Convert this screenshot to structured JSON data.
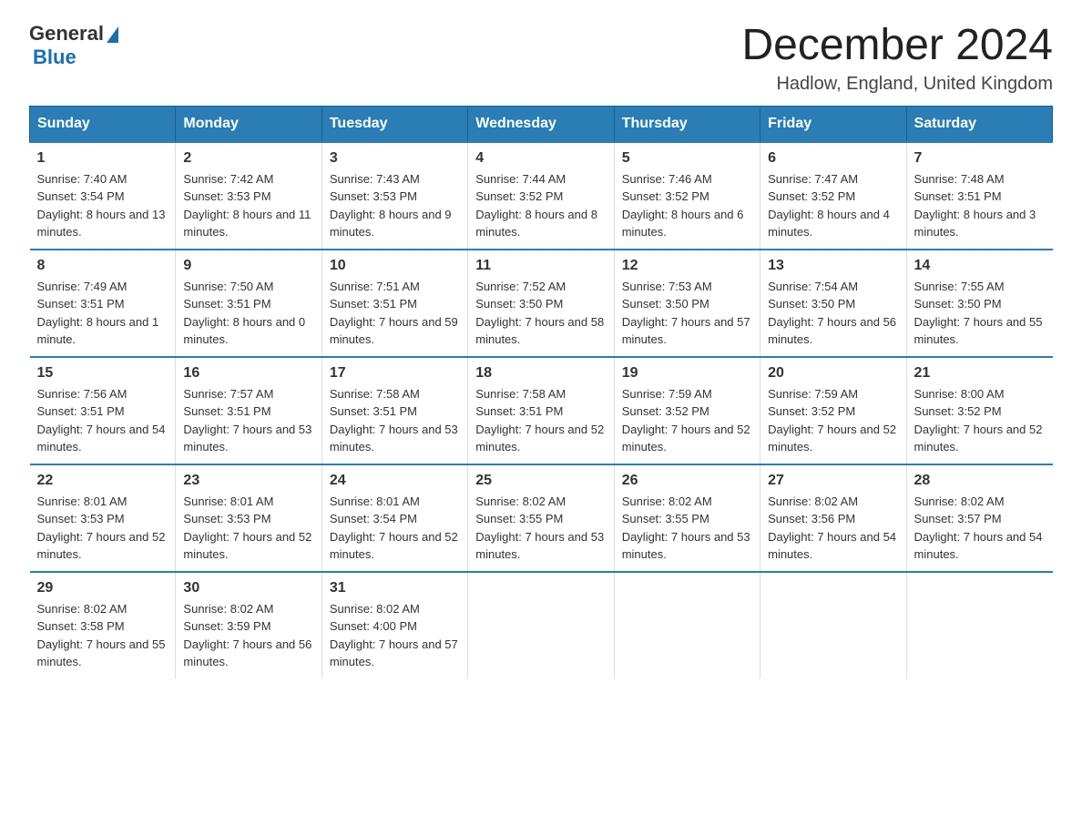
{
  "header": {
    "logo": {
      "general": "General",
      "blue": "Blue"
    },
    "title": "December 2024",
    "location": "Hadlow, England, United Kingdom"
  },
  "weekdays": [
    "Sunday",
    "Monday",
    "Tuesday",
    "Wednesday",
    "Thursday",
    "Friday",
    "Saturday"
  ],
  "weeks": [
    [
      {
        "day": "1",
        "sunrise": "7:40 AM",
        "sunset": "3:54 PM",
        "daylight": "8 hours and 13 minutes."
      },
      {
        "day": "2",
        "sunrise": "7:42 AM",
        "sunset": "3:53 PM",
        "daylight": "8 hours and 11 minutes."
      },
      {
        "day": "3",
        "sunrise": "7:43 AM",
        "sunset": "3:53 PM",
        "daylight": "8 hours and 9 minutes."
      },
      {
        "day": "4",
        "sunrise": "7:44 AM",
        "sunset": "3:52 PM",
        "daylight": "8 hours and 8 minutes."
      },
      {
        "day": "5",
        "sunrise": "7:46 AM",
        "sunset": "3:52 PM",
        "daylight": "8 hours and 6 minutes."
      },
      {
        "day": "6",
        "sunrise": "7:47 AM",
        "sunset": "3:52 PM",
        "daylight": "8 hours and 4 minutes."
      },
      {
        "day": "7",
        "sunrise": "7:48 AM",
        "sunset": "3:51 PM",
        "daylight": "8 hours and 3 minutes."
      }
    ],
    [
      {
        "day": "8",
        "sunrise": "7:49 AM",
        "sunset": "3:51 PM",
        "daylight": "8 hours and 1 minute."
      },
      {
        "day": "9",
        "sunrise": "7:50 AM",
        "sunset": "3:51 PM",
        "daylight": "8 hours and 0 minutes."
      },
      {
        "day": "10",
        "sunrise": "7:51 AM",
        "sunset": "3:51 PM",
        "daylight": "7 hours and 59 minutes."
      },
      {
        "day": "11",
        "sunrise": "7:52 AM",
        "sunset": "3:50 PM",
        "daylight": "7 hours and 58 minutes."
      },
      {
        "day": "12",
        "sunrise": "7:53 AM",
        "sunset": "3:50 PM",
        "daylight": "7 hours and 57 minutes."
      },
      {
        "day": "13",
        "sunrise": "7:54 AM",
        "sunset": "3:50 PM",
        "daylight": "7 hours and 56 minutes."
      },
      {
        "day": "14",
        "sunrise": "7:55 AM",
        "sunset": "3:50 PM",
        "daylight": "7 hours and 55 minutes."
      }
    ],
    [
      {
        "day": "15",
        "sunrise": "7:56 AM",
        "sunset": "3:51 PM",
        "daylight": "7 hours and 54 minutes."
      },
      {
        "day": "16",
        "sunrise": "7:57 AM",
        "sunset": "3:51 PM",
        "daylight": "7 hours and 53 minutes."
      },
      {
        "day": "17",
        "sunrise": "7:58 AM",
        "sunset": "3:51 PM",
        "daylight": "7 hours and 53 minutes."
      },
      {
        "day": "18",
        "sunrise": "7:58 AM",
        "sunset": "3:51 PM",
        "daylight": "7 hours and 52 minutes."
      },
      {
        "day": "19",
        "sunrise": "7:59 AM",
        "sunset": "3:52 PM",
        "daylight": "7 hours and 52 minutes."
      },
      {
        "day": "20",
        "sunrise": "7:59 AM",
        "sunset": "3:52 PM",
        "daylight": "7 hours and 52 minutes."
      },
      {
        "day": "21",
        "sunrise": "8:00 AM",
        "sunset": "3:52 PM",
        "daylight": "7 hours and 52 minutes."
      }
    ],
    [
      {
        "day": "22",
        "sunrise": "8:01 AM",
        "sunset": "3:53 PM",
        "daylight": "7 hours and 52 minutes."
      },
      {
        "day": "23",
        "sunrise": "8:01 AM",
        "sunset": "3:53 PM",
        "daylight": "7 hours and 52 minutes."
      },
      {
        "day": "24",
        "sunrise": "8:01 AM",
        "sunset": "3:54 PM",
        "daylight": "7 hours and 52 minutes."
      },
      {
        "day": "25",
        "sunrise": "8:02 AM",
        "sunset": "3:55 PM",
        "daylight": "7 hours and 53 minutes."
      },
      {
        "day": "26",
        "sunrise": "8:02 AM",
        "sunset": "3:55 PM",
        "daylight": "7 hours and 53 minutes."
      },
      {
        "day": "27",
        "sunrise": "8:02 AM",
        "sunset": "3:56 PM",
        "daylight": "7 hours and 54 minutes."
      },
      {
        "day": "28",
        "sunrise": "8:02 AM",
        "sunset": "3:57 PM",
        "daylight": "7 hours and 54 minutes."
      }
    ],
    [
      {
        "day": "29",
        "sunrise": "8:02 AM",
        "sunset": "3:58 PM",
        "daylight": "7 hours and 55 minutes."
      },
      {
        "day": "30",
        "sunrise": "8:02 AM",
        "sunset": "3:59 PM",
        "daylight": "7 hours and 56 minutes."
      },
      {
        "day": "31",
        "sunrise": "8:02 AM",
        "sunset": "4:00 PM",
        "daylight": "7 hours and 57 minutes."
      },
      null,
      null,
      null,
      null
    ]
  ]
}
